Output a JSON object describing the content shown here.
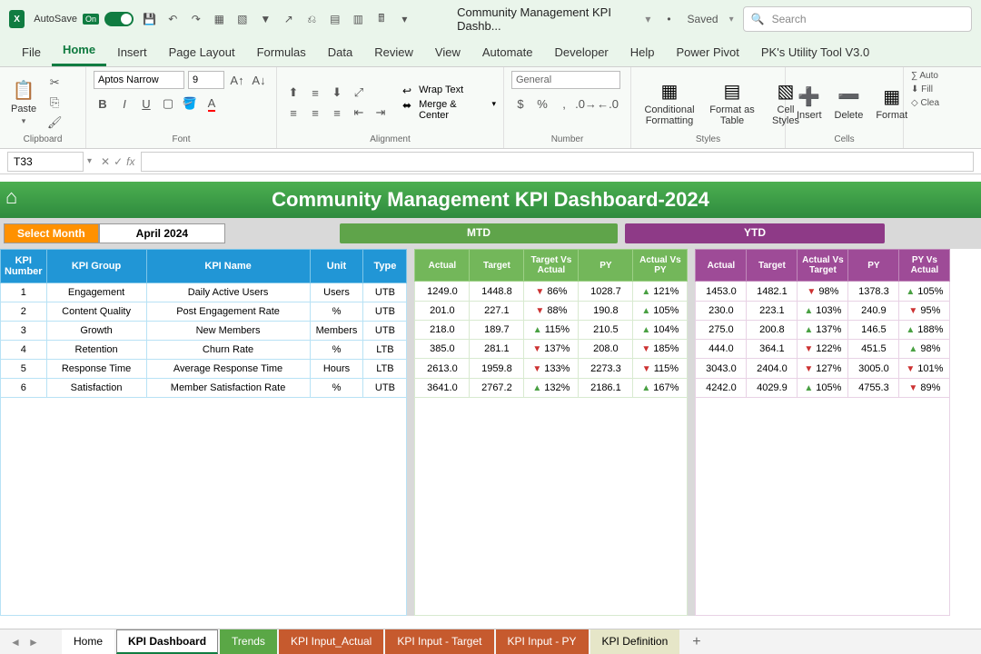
{
  "titlebar": {
    "autosave": "AutoSave",
    "toggle_state": "On",
    "doc_title": "Community Management KPI Dashb...",
    "saved_state_bullet": "•",
    "saved_state": "Saved",
    "search_placeholder": "Search"
  },
  "ribbon_tabs": [
    "File",
    "Home",
    "Insert",
    "Page Layout",
    "Formulas",
    "Data",
    "Review",
    "View",
    "Automate",
    "Developer",
    "Help",
    "Power Pivot",
    "PK's Utility Tool V3.0"
  ],
  "active_tab": "Home",
  "ribbon": {
    "clipboard_label": "Clipboard",
    "paste": "Paste",
    "font_label": "Font",
    "font_name": "Aptos Narrow",
    "font_size": "9",
    "alignment_label": "Alignment",
    "wrap_text": "Wrap Text",
    "merge_center": "Merge & Center",
    "number_label": "Number",
    "number_format": "General",
    "styles_label": "Styles",
    "cond_fmt": "Conditional Formatting",
    "fmt_table": "Format as Table",
    "cell_styles": "Cell Styles",
    "cells_label": "Cells",
    "insert": "Insert",
    "delete": "Delete",
    "format": "Format",
    "editing_autosum": "Auto",
    "editing_fill": "Fill",
    "editing_clear": "Clea"
  },
  "formula_bar": {
    "cell_ref": "T33",
    "formula": ""
  },
  "dashboard": {
    "title": "Community Management KPI Dashboard-2024",
    "select_month_label": "Select Month",
    "selected_month": "April 2024",
    "mtd_label": "MTD",
    "ytd_label": "YTD",
    "info_headers": [
      "KPI Number",
      "KPI Group",
      "KPI Name",
      "Unit",
      "Type"
    ],
    "mtd_headers": [
      "Actual",
      "Target",
      "Target Vs Actual",
      "PY",
      "Actual Vs PY"
    ],
    "ytd_headers": [
      "Actual",
      "Target",
      "Actual Vs Target",
      "PY",
      "PY Vs Actual"
    ],
    "rows": [
      {
        "num": "1",
        "group": "Engagement",
        "name": "Daily Active Users",
        "unit": "Users",
        "type": "UTB",
        "m_actual": "1249.0",
        "m_target": "1448.8",
        "m_tva_dir": "dn",
        "m_tva": "86%",
        "m_py": "1028.7",
        "m_avp_dir": "up",
        "m_avp": "121%",
        "y_actual": "1453.0",
        "y_target": "1482.1",
        "y_avt_dir": "dn",
        "y_avt": "98%",
        "y_py": "1378.3",
        "y_pva_dir": "up",
        "y_pva": "105%"
      },
      {
        "num": "2",
        "group": "Content Quality",
        "name": "Post Engagement Rate",
        "unit": "%",
        "type": "UTB",
        "m_actual": "201.0",
        "m_target": "227.1",
        "m_tva_dir": "dn",
        "m_tva": "88%",
        "m_py": "190.8",
        "m_avp_dir": "up",
        "m_avp": "105%",
        "y_actual": "230.0",
        "y_target": "223.1",
        "y_avt_dir": "up",
        "y_avt": "103%",
        "y_py": "240.9",
        "y_pva_dir": "dn",
        "y_pva": "95%"
      },
      {
        "num": "3",
        "group": "Growth",
        "name": "New Members",
        "unit": "Members",
        "type": "UTB",
        "m_actual": "218.0",
        "m_target": "189.7",
        "m_tva_dir": "up",
        "m_tva": "115%",
        "m_py": "210.5",
        "m_avp_dir": "up",
        "m_avp": "104%",
        "y_actual": "275.0",
        "y_target": "200.8",
        "y_avt_dir": "up",
        "y_avt": "137%",
        "y_py": "146.5",
        "y_pva_dir": "up",
        "y_pva": "188%"
      },
      {
        "num": "4",
        "group": "Retention",
        "name": "Churn Rate",
        "unit": "%",
        "type": "LTB",
        "m_actual": "385.0",
        "m_target": "281.1",
        "m_tva_dir": "dn",
        "m_tva": "137%",
        "m_py": "208.0",
        "m_avp_dir": "dn",
        "m_avp": "185%",
        "y_actual": "444.0",
        "y_target": "364.1",
        "y_avt_dir": "dn",
        "y_avt": "122%",
        "y_py": "451.5",
        "y_pva_dir": "up",
        "y_pva": "98%"
      },
      {
        "num": "5",
        "group": "Response Time",
        "name": "Average Response Time",
        "unit": "Hours",
        "type": "LTB",
        "m_actual": "2613.0",
        "m_target": "1959.8",
        "m_tva_dir": "dn",
        "m_tva": "133%",
        "m_py": "2273.3",
        "m_avp_dir": "dn",
        "m_avp": "115%",
        "y_actual": "3043.0",
        "y_target": "2404.0",
        "y_avt_dir": "dn",
        "y_avt": "127%",
        "y_py": "3005.0",
        "y_pva_dir": "dn",
        "y_pva": "101%"
      },
      {
        "num": "6",
        "group": "Satisfaction",
        "name": "Member Satisfaction Rate",
        "unit": "%",
        "type": "UTB",
        "m_actual": "3641.0",
        "m_target": "2767.2",
        "m_tva_dir": "up",
        "m_tva": "132%",
        "m_py": "2186.1",
        "m_avp_dir": "up",
        "m_avp": "167%",
        "y_actual": "4242.0",
        "y_target": "4029.9",
        "y_avt_dir": "up",
        "y_avt": "105%",
        "y_py": "4755.3",
        "y_pva_dir": "dn",
        "y_pva": "89%"
      }
    ]
  },
  "sheet_tabs": [
    {
      "label": "Home",
      "cls": "white"
    },
    {
      "label": "KPI Dashboard",
      "cls": "active"
    },
    {
      "label": "Trends",
      "cls": "green"
    },
    {
      "label": "KPI Input_Actual",
      "cls": "orange"
    },
    {
      "label": "KPI Input - Target",
      "cls": "orange"
    },
    {
      "label": "KPI Input - PY",
      "cls": "orange"
    },
    {
      "label": "KPI Definition",
      "cls": "yellow"
    }
  ],
  "chart_data": {
    "type": "table",
    "title": "Community Management KPI Dashboard-2024",
    "month": "April 2024",
    "columns": [
      "KPI Number",
      "KPI Group",
      "KPI Name",
      "Unit",
      "Type",
      "MTD Actual",
      "MTD Target",
      "MTD Target Vs Actual %",
      "MTD PY",
      "MTD Actual Vs PY %",
      "YTD Actual",
      "YTD Target",
      "YTD Actual Vs Target %",
      "YTD PY",
      "YTD PY Vs Actual %"
    ],
    "rows": [
      [
        1,
        "Engagement",
        "Daily Active Users",
        "Users",
        "UTB",
        1249.0,
        1448.8,
        86,
        1028.7,
        121,
        1453.0,
        1482.1,
        98,
        1378.3,
        105
      ],
      [
        2,
        "Content Quality",
        "Post Engagement Rate",
        "%",
        "UTB",
        201.0,
        227.1,
        88,
        190.8,
        105,
        230.0,
        223.1,
        103,
        240.9,
        95
      ],
      [
        3,
        "Growth",
        "New Members",
        "Members",
        "UTB",
        218.0,
        189.7,
        115,
        210.5,
        104,
        275.0,
        200.8,
        137,
        146.5,
        188
      ],
      [
        4,
        "Retention",
        "Churn Rate",
        "%",
        "LTB",
        385.0,
        281.1,
        137,
        208.0,
        185,
        444.0,
        364.1,
        122,
        451.5,
        98
      ],
      [
        5,
        "Response Time",
        "Average Response Time",
        "Hours",
        "LTB",
        2613.0,
        1959.8,
        133,
        2273.3,
        115,
        3043.0,
        2404.0,
        127,
        3005.0,
        101
      ],
      [
        6,
        "Satisfaction",
        "Member Satisfaction Rate",
        "%",
        "UTB",
        3641.0,
        2767.2,
        132,
        2186.1,
        167,
        4242.0,
        4029.9,
        105,
        4755.3,
        89
      ]
    ]
  }
}
